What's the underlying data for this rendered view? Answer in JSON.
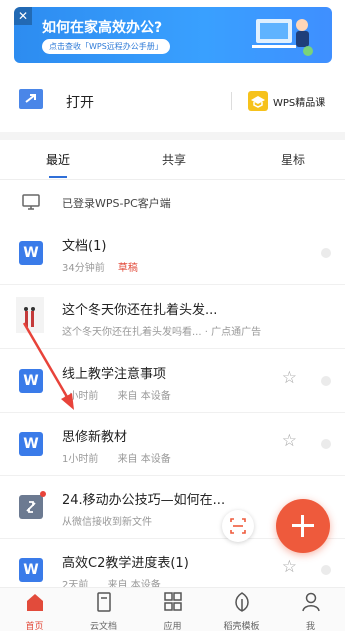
{
  "banner": {
    "close": "✕",
    "title": "如何在家高效办公?",
    "subtitle": "点击查收「WPS远程办公手册」"
  },
  "open_row": {
    "label": "打开",
    "course_label": "WPS精品课"
  },
  "tabs": {
    "recent": "最近",
    "shared": "共享",
    "starred": "星标"
  },
  "logged_in_text": "已登录WPS-PC客户端",
  "files": [
    {
      "name": "文档(1)",
      "time": "34分钟前",
      "tag": "草稿",
      "icon": "W"
    },
    {
      "name": "这个冬天你还在扎着头发...",
      "subtitle": "这个冬天你还在扎着头发吗看...",
      "ad": "· 广点通广告"
    },
    {
      "name": "线上教学注意事项",
      "time": "1小时前",
      "source": "来自 本设备",
      "icon": "W"
    },
    {
      "name": "思修新教材",
      "time": "1小时前",
      "source": "来自 本设备",
      "icon": "W"
    },
    {
      "name": "24.移动办公技巧—如何在...",
      "subtitle": "从微信接收到新文件"
    },
    {
      "name": "高效C2教学进度表(1)",
      "time": "2天前",
      "source": "来自 本设备",
      "icon": "W"
    }
  ],
  "nav": {
    "home": "首页",
    "cloud": "云文档",
    "apps": "应用",
    "templates": "稻壳模板",
    "me": "我"
  },
  "colors": {
    "accent": "#3a7be9",
    "fab": "#ee5a3c",
    "active_nav": "#e24b3b",
    "annotation_arrow": "#e8433a"
  }
}
